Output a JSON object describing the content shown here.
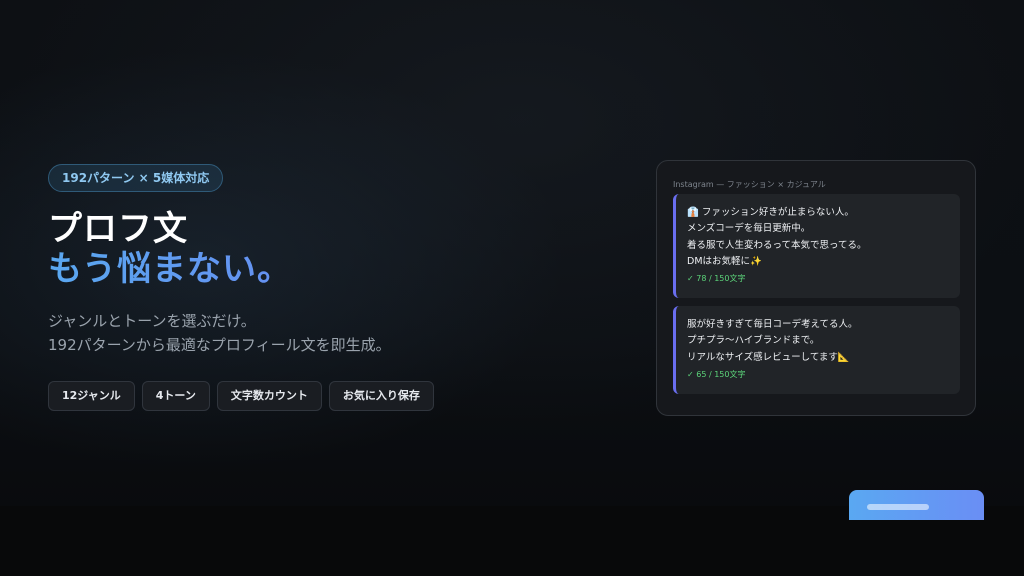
{
  "hero": {
    "badge": "192パターン × 5媒体対応",
    "title_line1": "プロフ文",
    "title_line2": "もう悩まない。",
    "desc_line1": "ジャンルとトーンを選ぶだけ。",
    "desc_line2": "192パターンから最適なプロフィール文を即生成。",
    "features": [
      "12ジャンル",
      "4トーン",
      "文字数カウント",
      "お気に入り保存"
    ]
  },
  "preview": {
    "label": "Instagram — ファッション × カジュアル",
    "cards": [
      {
        "lines": [
          "👔 ファッション好きが止まらない人。",
          "メンズコーデを毎日更新中。",
          "着る服で人生変わるって本気で思ってる。",
          "DMはお気軽に✨"
        ],
        "count": "✓ 78 / 150文字"
      },
      {
        "lines": [
          "服が好きすぎて毎日コーデ考えてる人。",
          "プチプラ〜ハイブランドまで。",
          "リアルなサイズ感レビューしてます📐"
        ],
        "count": "✓ 65 / 150文字"
      }
    ]
  },
  "colors": {
    "accent_blue": "#5aa8f0",
    "accent_indigo": "#6a6ef0",
    "success_green": "#5cd47a"
  }
}
